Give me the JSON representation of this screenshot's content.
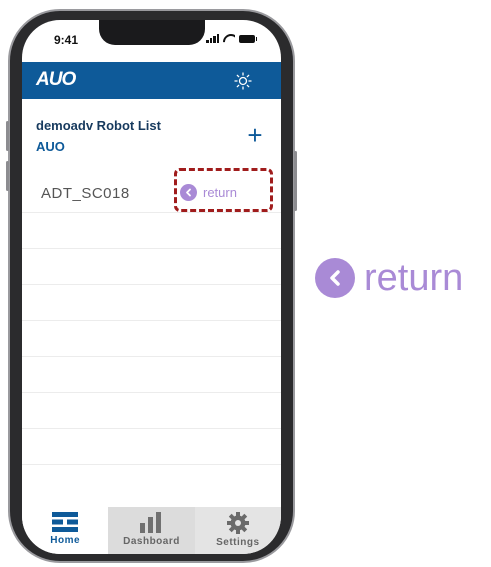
{
  "status_bar": {
    "time": "9:41"
  },
  "header": {
    "logo": "AUO",
    "theme_icon": "sun-icon"
  },
  "list": {
    "title": "demoadv Robot List",
    "subtitle": "AUO",
    "add_icon": "+",
    "robots": [
      {
        "name": "ADT_SC018",
        "action_label": "return"
      }
    ]
  },
  "tabbar": {
    "tabs": [
      {
        "label": "Home",
        "icon": "home-icon"
      },
      {
        "label": "Dashboard",
        "icon": "bar-chart-icon"
      },
      {
        "label": "Settings",
        "icon": "gear-icon"
      }
    ]
  },
  "zoom": {
    "label": "return"
  },
  "colors": {
    "header": "#0e5a99",
    "accent": "#a98ad6",
    "highlight": "#a01c1c",
    "title": "#173a5e"
  }
}
